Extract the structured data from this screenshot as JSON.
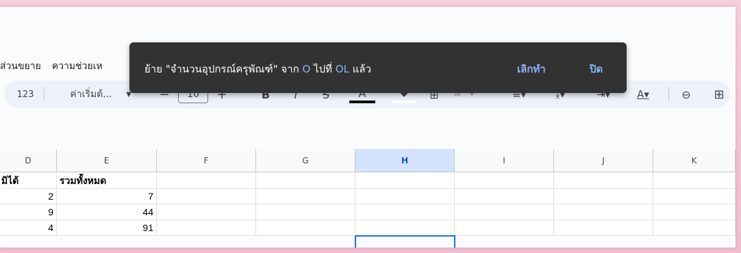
{
  "menu": {
    "extensions": "ส่วนขยาย",
    "help": "ความช่วยเห"
  },
  "toolbar": {
    "number_format": "123",
    "font_name": "ค่าเริ่มต้...",
    "font_size": "10",
    "decrease_size": "−",
    "increase_size": "+",
    "bold": "B",
    "italic": "I",
    "strike": "S",
    "text_color": "A"
  },
  "toast": {
    "message_part1": "ย้าย \"จำนวนอุปกรณ์ครุพัณฑ์\" จาก ",
    "from_col": "O",
    "message_part2": " ไปที่ ",
    "to_col": "OL",
    "message_part3": " แล้ว",
    "undo": "เลิกทำ",
    "close": "ปิด"
  },
  "columns": [
    "D",
    "E",
    "F",
    "G",
    "H",
    "I",
    "J",
    "K"
  ],
  "selected_column": "H",
  "rows": [
    {
      "D": "มิได้",
      "E": "รวมทั้งหมด"
    },
    {
      "D": "2",
      "E": "7"
    },
    {
      "D": "9",
      "E": "44"
    },
    {
      "D": "4",
      "E": "91"
    }
  ],
  "colors": {
    "accent": "#1a73e8",
    "toast_bg": "#323232",
    "toast_link": "#8ab4f8",
    "toolbar_bg": "#edf2fa"
  }
}
